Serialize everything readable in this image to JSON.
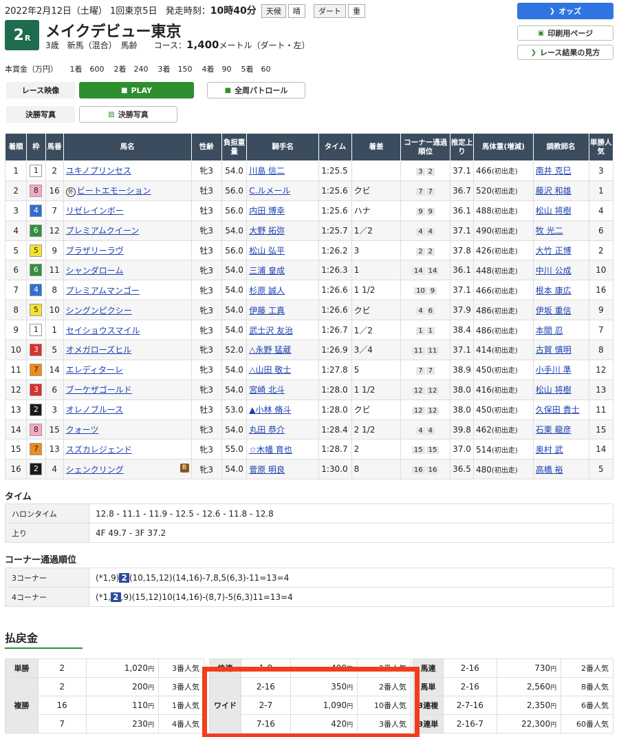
{
  "header": {
    "date_info": "2022年2月12日（土曜） 1回東京5日",
    "start_label": "発走時刻：",
    "start_time": "10時40分",
    "weather_label": "天候",
    "weather": "晴",
    "track_label": "ダート",
    "track_cond": "重"
  },
  "race": {
    "number": "2",
    "suffix": "R",
    "name": "メイクデビュー東京",
    "cond_prefix": "3歳　新馬（混合）　馬齢　　コース：",
    "distance": "1,400",
    "cond_suffix": "メートル（ダート・左）"
  },
  "prize": {
    "label": "本賞金（万円）",
    "items": [
      "1着　600",
      "2着　240",
      "3着　150",
      "4着　90",
      "5着　60"
    ]
  },
  "buttons": {
    "odds": "オッズ",
    "print": "印刷用ページ",
    "howto": "レース結果の見方",
    "video_label": "レース映像",
    "play": "PLAY",
    "patrol": "全周パトロール",
    "photo_label": "決勝写真",
    "photo": "決勝写真"
  },
  "results": {
    "headers": [
      "着順",
      "枠",
      "馬番",
      "馬名",
      "性齢",
      "負担重量",
      "騎手名",
      "タイム",
      "着差",
      "コーナー通過順位",
      "推定上り",
      "馬体重(増減)",
      "調教師名",
      "単勝人気"
    ],
    "rows": [
      {
        "pos": "1",
        "waku": "1",
        "num": "2",
        "horse": "ユキノプリンセス",
        "mark": "",
        "blink": "",
        "sex": "牝3",
        "wt": "54.0",
        "jockey": "川島 信二",
        "time": "1:25.5",
        "margin": "",
        "c1": "3",
        "c2": "2",
        "last": "37.1",
        "bw": "466",
        "bwd": "(初出走)",
        "trainer": "南井 克巳",
        "pop": "3"
      },
      {
        "pos": "2",
        "waku": "8",
        "num": "16",
        "horse": "ビートエモーション",
        "mark": "外",
        "blink": "",
        "sex": "牡3",
        "wt": "56.0",
        "jockey": "C.ルメール",
        "time": "1:25.6",
        "margin": "クビ",
        "c1": "7",
        "c2": "7",
        "last": "36.7",
        "bw": "520",
        "bwd": "(初出走)",
        "trainer": "藤沢 和雄",
        "pop": "1"
      },
      {
        "pos": "3",
        "waku": "4",
        "num": "7",
        "horse": "リゼレインボー",
        "mark": "",
        "blink": "",
        "sex": "牡3",
        "wt": "56.0",
        "jockey": "内田 博幸",
        "time": "1:25.6",
        "margin": "ハナ",
        "c1": "9",
        "c2": "9",
        "last": "36.1",
        "bw": "488",
        "bwd": "(初出走)",
        "trainer": "松山 将樹",
        "pop": "4"
      },
      {
        "pos": "4",
        "waku": "6",
        "num": "12",
        "horse": "プレミアムクイーン",
        "mark": "",
        "blink": "",
        "sex": "牝3",
        "wt": "54.0",
        "jockey": "大野 拓弥",
        "time": "1:25.7",
        "margin": "1／2",
        "c1": "4",
        "c2": "4",
        "last": "37.1",
        "bw": "490",
        "bwd": "(初出走)",
        "trainer": "牧 光二",
        "pop": "6"
      },
      {
        "pos": "5",
        "waku": "5",
        "num": "9",
        "horse": "ブラザリーラヴ",
        "mark": "",
        "blink": "",
        "sex": "牡3",
        "wt": "56.0",
        "jockey": "松山 弘平",
        "time": "1:26.2",
        "margin": "3",
        "c1": "2",
        "c2": "2",
        "last": "37.8",
        "bw": "426",
        "bwd": "(初出走)",
        "trainer": "大竹 正博",
        "pop": "2"
      },
      {
        "pos": "6",
        "waku": "6",
        "num": "11",
        "horse": "シャンダローム",
        "mark": "",
        "blink": "",
        "sex": "牝3",
        "wt": "54.0",
        "jockey": "三浦 皇成",
        "time": "1:26.3",
        "margin": "1",
        "c1": "14",
        "c2": "14",
        "last": "36.1",
        "bw": "448",
        "bwd": "(初出走)",
        "trainer": "中川 公成",
        "pop": "10"
      },
      {
        "pos": "7",
        "waku": "4",
        "num": "8",
        "horse": "プレミアムマンゴー",
        "mark": "",
        "blink": "",
        "sex": "牝3",
        "wt": "54.0",
        "jockey": "杉原 誠人",
        "time": "1:26.6",
        "margin": "1 1/2",
        "c1": "10",
        "c2": "9",
        "last": "37.1",
        "bw": "466",
        "bwd": "(初出走)",
        "trainer": "根本 康広",
        "pop": "16"
      },
      {
        "pos": "8",
        "waku": "5",
        "num": "10",
        "horse": "シングンピクシー",
        "mark": "",
        "blink": "",
        "sex": "牝3",
        "wt": "54.0",
        "jockey": "伊藤 工真",
        "time": "1:26.6",
        "margin": "クビ",
        "c1": "4",
        "c2": "6",
        "last": "37.9",
        "bw": "486",
        "bwd": "(初出走)",
        "trainer": "伊坂 重信",
        "pop": "9"
      },
      {
        "pos": "9",
        "waku": "1",
        "num": "1",
        "horse": "セイショウスマイル",
        "mark": "",
        "blink": "",
        "sex": "牝3",
        "wt": "54.0",
        "jockey": "武士沢 友治",
        "time": "1:26.7",
        "margin": "1／2",
        "c1": "1",
        "c2": "1",
        "last": "38.4",
        "bw": "486",
        "bwd": "(初出走)",
        "trainer": "本間 忍",
        "pop": "7"
      },
      {
        "pos": "10",
        "waku": "3",
        "num": "5",
        "horse": "オメガローズヒル",
        "mark": "",
        "blink": "",
        "sex": "牝3",
        "wt": "52.0",
        "jockey": "△永野 猛蔵",
        "time": "1:26.9",
        "margin": "3／4",
        "c1": "11",
        "c2": "11",
        "last": "37.1",
        "bw": "414",
        "bwd": "(初出走)",
        "trainer": "古賀 慎明",
        "pop": "8"
      },
      {
        "pos": "11",
        "waku": "7",
        "num": "14",
        "horse": "エレディターレ",
        "mark": "",
        "blink": "",
        "sex": "牝3",
        "wt": "54.0",
        "jockey": "△山田 敬士",
        "time": "1:27.8",
        "margin": "5",
        "c1": "7",
        "c2": "7",
        "last": "38.9",
        "bw": "450",
        "bwd": "(初出走)",
        "trainer": "小手川 準",
        "pop": "12"
      },
      {
        "pos": "12",
        "waku": "3",
        "num": "6",
        "horse": "ブーケザゴールド",
        "mark": "",
        "blink": "",
        "sex": "牝3",
        "wt": "54.0",
        "jockey": "宮崎 北斗",
        "time": "1:28.0",
        "margin": "1 1/2",
        "c1": "12",
        "c2": "12",
        "last": "38.0",
        "bw": "416",
        "bwd": "(初出走)",
        "trainer": "松山 将樹",
        "pop": "13"
      },
      {
        "pos": "13",
        "waku": "2",
        "num": "3",
        "horse": "オレノブルース",
        "mark": "",
        "blink": "",
        "sex": "牡3",
        "wt": "53.0",
        "jockey": "▲小林 脩斗",
        "time": "1:28.0",
        "margin": "クビ",
        "c1": "12",
        "c2": "12",
        "last": "38.0",
        "bw": "450",
        "bwd": "(初出走)",
        "trainer": "久保田 貴士",
        "pop": "11"
      },
      {
        "pos": "14",
        "waku": "8",
        "num": "15",
        "horse": "クォーツ",
        "mark": "",
        "blink": "",
        "sex": "牝3",
        "wt": "54.0",
        "jockey": "丸田 恭介",
        "time": "1:28.4",
        "margin": "2 1/2",
        "c1": "4",
        "c2": "4",
        "last": "39.8",
        "bw": "462",
        "bwd": "(初出走)",
        "trainer": "石栗 龍彦",
        "pop": "15"
      },
      {
        "pos": "15",
        "waku": "7",
        "num": "13",
        "horse": "スズカレジェンド",
        "mark": "",
        "blink": "",
        "sex": "牝3",
        "wt": "55.0",
        "jockey": "☆木幡 育也",
        "time": "1:28.7",
        "margin": "2",
        "c1": "15",
        "c2": "15",
        "last": "37.0",
        "bw": "514",
        "bwd": "(初出走)",
        "trainer": "奥村 武",
        "pop": "14"
      },
      {
        "pos": "16",
        "waku": "2",
        "num": "4",
        "horse": "シェンクリング",
        "mark": "",
        "blink": "B",
        "sex": "牝3",
        "wt": "54.0",
        "jockey": "菅原 明良",
        "time": "1:30.0",
        "margin": "8",
        "c1": "16",
        "c2": "16",
        "last": "36.5",
        "bw": "480",
        "bwd": "(初出走)",
        "trainer": "高橋 裕",
        "pop": "5"
      }
    ]
  },
  "time_section": {
    "title": "タイム",
    "furlong_label": "ハロンタイム",
    "furlong": "12.8 - 11.1 - 11.9 - 12.5 - 12.6 - 11.8 - 12.8",
    "last_label": "上り",
    "last": "4F 49.7 - 3F 37.2"
  },
  "corner_section": {
    "title": "コーナー通過順位",
    "c3_label": "3コーナー",
    "c3_pre": "(*1,9)",
    "c3_hl": "2",
    "c3_post": "(10,15,12)(14,16)-7,8,5(6,3)-11=13=4",
    "c4_label": "4コーナー",
    "c4_pre": "(*1,",
    "c4_hl": "2",
    "c4_post": ",9)(15,12)10(14,16)-(8,7)-5(6,3)11=13=4"
  },
  "payout": {
    "title": "払戻金",
    "yen": "円",
    "win": {
      "label": "単勝",
      "num": "2",
      "amt": "1,020",
      "pop": "3番人気"
    },
    "place": {
      "label": "複勝",
      "rows": [
        {
          "num": "2",
          "amt": "200",
          "pop": "3番人気"
        },
        {
          "num": "16",
          "amt": "110",
          "pop": "1番人気"
        },
        {
          "num": "7",
          "amt": "230",
          "pop": "4番人気"
        }
      ]
    },
    "bracket": {
      "label": "枠連",
      "num": "1-8",
      "amt": "490",
      "pop": "2番人気"
    },
    "wide": {
      "label": "ワイド",
      "rows": [
        {
          "num": "2-16",
          "amt": "350",
          "pop": "2番人気"
        },
        {
          "num": "2-7",
          "amt": "1,090",
          "pop": "10番人気"
        },
        {
          "num": "7-16",
          "amt": "420",
          "pop": "3番人気"
        }
      ]
    },
    "right": [
      {
        "label": "馬連",
        "num": "2-16",
        "amt": "730",
        "pop": "2番人気"
      },
      {
        "label": "馬単",
        "num": "2-16",
        "amt": "2,560",
        "pop": "8番人気"
      },
      {
        "label": "3連複",
        "num": "2-7-16",
        "amt": "2,350",
        "pop": "6番人気"
      },
      {
        "label": "3連単",
        "num": "2-16-7",
        "amt": "22,300",
        "pop": "60番人気"
      }
    ]
  },
  "colors": {
    "waku": {
      "1": "#ffffff",
      "2": "#1a1a1a",
      "3": "#d9302c",
      "4": "#2f6fd0",
      "5": "#f5e12f",
      "6": "#2f8f3f",
      "7": "#f08a1f",
      "8": "#f5a9c0"
    },
    "highlight": "#f23d1c"
  }
}
